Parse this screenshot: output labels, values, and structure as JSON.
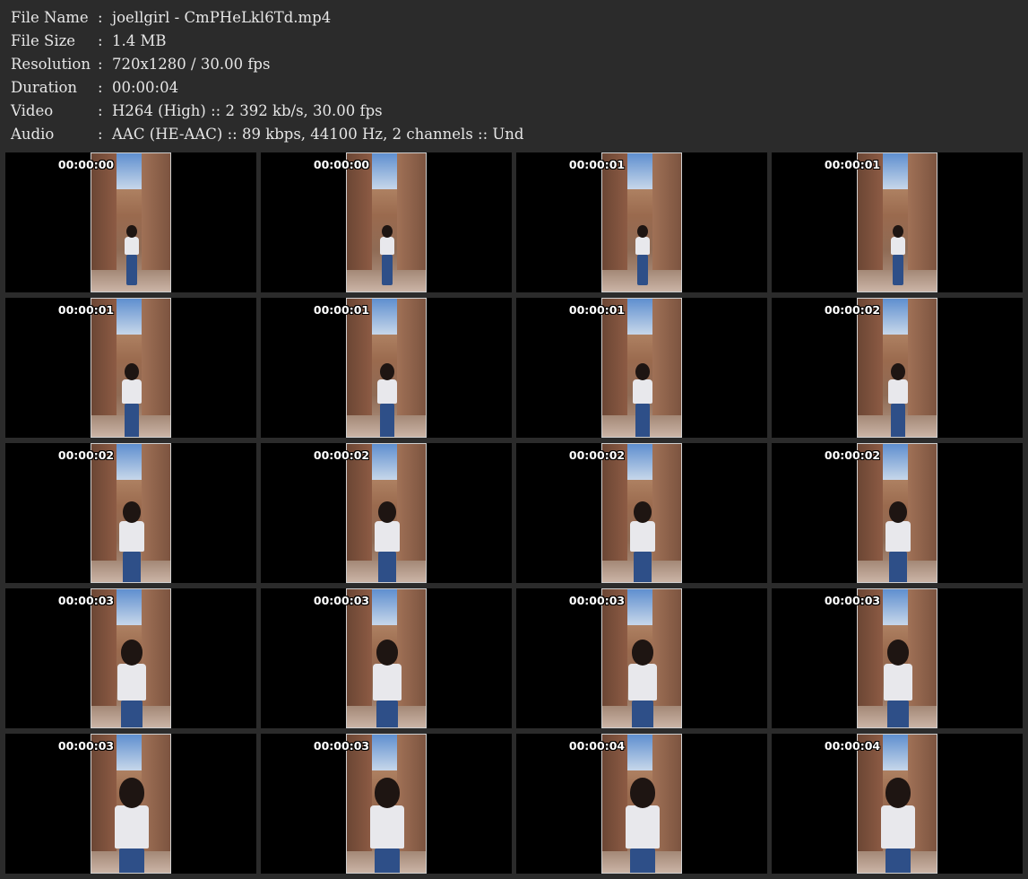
{
  "info": [
    {
      "label": "File Name",
      "value": "joellgirl - CmPHeLkl6Td.mp4"
    },
    {
      "label": "File Size",
      "value": "1.4 MB"
    },
    {
      "label": "Resolution",
      "value": "720x1280 / 30.00 fps"
    },
    {
      "label": "Duration",
      "value": "00:00:04"
    },
    {
      "label": "Video",
      "value": "H264 (High) :: 2 392 kb/s, 30.00 fps"
    },
    {
      "label": "Audio",
      "value": "AAC (HE-AAC) :: 89 kbps, 44100 Hz, 2 channels :: Und"
    }
  ],
  "separator": ":",
  "thumbnails": [
    [
      "00:00:00",
      "00:00:00",
      "00:00:01",
      "00:00:01"
    ],
    [
      "00:00:01",
      "00:00:01",
      "00:00:01",
      "00:00:02"
    ],
    [
      "00:00:02",
      "00:00:02",
      "00:00:02",
      "00:00:02"
    ],
    [
      "00:00:03",
      "00:00:03",
      "00:00:03",
      "00:00:03"
    ],
    [
      "00:00:03",
      "00:00:03",
      "00:00:04",
      "00:00:04"
    ]
  ],
  "colors": {
    "background": "#2b2b2b",
    "cell": "#000000",
    "text": "#e6e6e6"
  }
}
